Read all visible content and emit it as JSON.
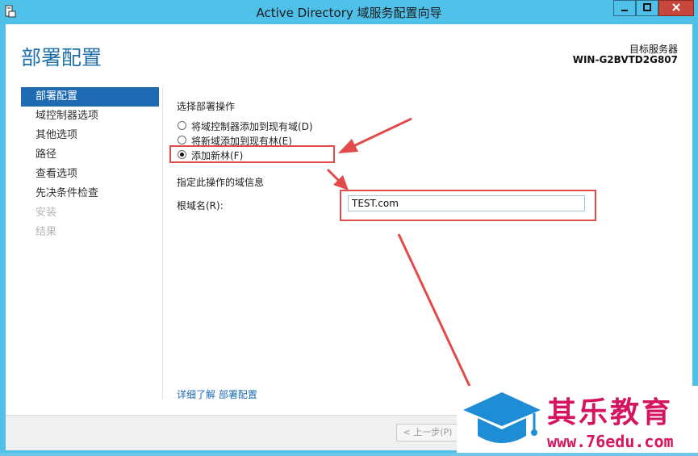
{
  "window": {
    "title": "Active Directory 域服务配置向导"
  },
  "header": {
    "page_title": "部署配置",
    "target_server_label": "目标服务器",
    "target_server_name": "WIN-G2BVTD2G807"
  },
  "nav": {
    "items": [
      {
        "label": "部署配置",
        "state": "active"
      },
      {
        "label": "域控制器选项",
        "state": "normal"
      },
      {
        "label": "其他选项",
        "state": "normal"
      },
      {
        "label": "路径",
        "state": "normal"
      },
      {
        "label": "查看选项",
        "state": "normal"
      },
      {
        "label": "先决条件检查",
        "state": "normal"
      },
      {
        "label": "安装",
        "state": "disabled"
      },
      {
        "label": "结果",
        "state": "disabled"
      }
    ]
  },
  "main": {
    "operation_heading": "选择部署操作",
    "options": [
      {
        "label": "将域控制器添加到现有域(D)",
        "selected": false
      },
      {
        "label": "将新域添加到现有林(E)",
        "selected": false
      },
      {
        "label": "添加新林(F)",
        "selected": true
      }
    ],
    "domain_info_heading": "指定此操作的域信息",
    "root_domain_label": "根域名(R):",
    "root_domain_value": "TEST.com",
    "more_link": "详细了解 部署配置"
  },
  "footer": {
    "prev_button": "< 上一步(P)"
  },
  "annotation": {
    "color": "#e14b4b"
  },
  "watermark": {
    "brand": "其乐教育",
    "url": "www.76edu.com",
    "color": "#d5155f"
  }
}
